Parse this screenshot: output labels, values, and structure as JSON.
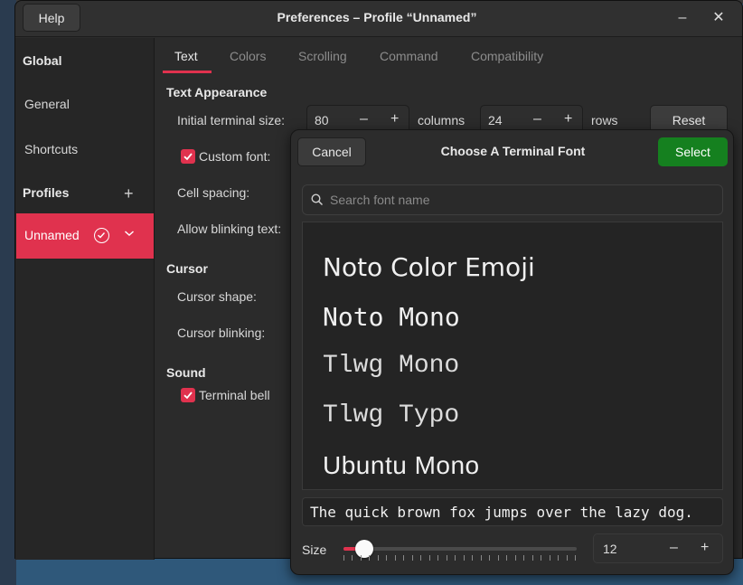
{
  "window": {
    "title": "Preferences – Profile “Unnamed”",
    "help_label": "Help",
    "minimize_icon": "–",
    "close_icon": "✕"
  },
  "sidebar": {
    "global_heading": "Global",
    "general_label": "General",
    "shortcuts_label": "Shortcuts",
    "profiles_heading": "Profiles",
    "add_profile_icon": "+",
    "profiles": [
      {
        "name": "Unnamed",
        "selected": true,
        "is_default": true
      }
    ],
    "accent_color": "#e0324e"
  },
  "tabs": [
    {
      "label": "Text",
      "active": true
    },
    {
      "label": "Colors",
      "active": false
    },
    {
      "label": "Scrolling",
      "active": false
    },
    {
      "label": "Command",
      "active": false
    },
    {
      "label": "Compatibility",
      "active": false
    }
  ],
  "text_tab": {
    "appearance_heading": "Text Appearance",
    "initial_size_label": "Initial terminal size:",
    "columns_value": "80",
    "columns_label": "columns",
    "rows_value": "24",
    "rows_label": "rows",
    "reset_label": "Reset",
    "custom_font_label": "Custom font:",
    "custom_font_checked": true,
    "cell_spacing_label": "Cell spacing:",
    "allow_blinking_label": "Allow blinking text:",
    "cursor_heading": "Cursor",
    "cursor_shape_label": "Cursor shape:",
    "cursor_blinking_label": "Cursor blinking:",
    "sound_heading": "Sound",
    "terminal_bell_label": "Terminal bell",
    "terminal_bell_checked": true
  },
  "font_dialog": {
    "title": "Choose A Terminal Font",
    "cancel_label": "Cancel",
    "select_label": "Select",
    "select_color": "#15801f",
    "search_placeholder": "Search font name",
    "fonts": [
      "Noto Color Emoji",
      "Noto Mono",
      "Tlwg Mono",
      "Tlwg Typo",
      "Ubuntu Mono"
    ],
    "preview_text": "The quick brown fox jumps over the lazy dog.",
    "size_label": "Size",
    "size_value": "12",
    "size_slider_fraction": 0.09,
    "size_minus": "–",
    "size_plus": "+"
  }
}
